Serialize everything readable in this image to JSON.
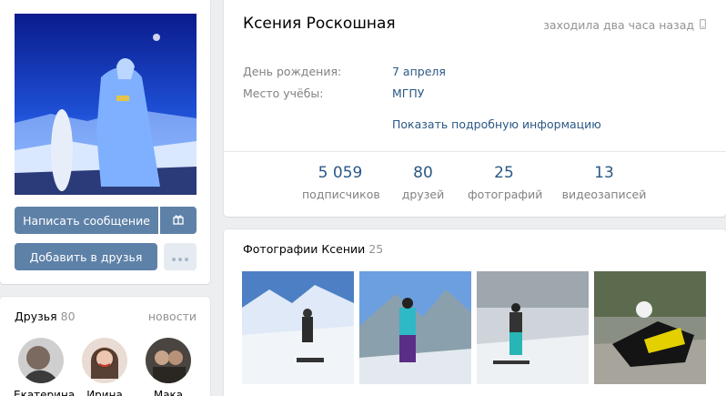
{
  "profile": {
    "name": "Ксения Роскошная",
    "last_seen": "заходила два часа назад",
    "info": [
      {
        "label": "День рождения:",
        "value": "7 апреля"
      },
      {
        "label": "Место учёбы:",
        "value": "МГПУ"
      }
    ],
    "more_info_link": "Показать подробную информацию"
  },
  "actions": {
    "message_label": "Написать сообщение",
    "gift_icon": "gift-icon",
    "add_friend_label": "Добавить в друзья",
    "more_icon": "more-dots-icon"
  },
  "counters": [
    {
      "value": "5 059",
      "label": "подписчиков"
    },
    {
      "value": "80",
      "label": "друзей"
    },
    {
      "value": "25",
      "label": "фотографий"
    },
    {
      "value": "13",
      "label": "видеозаписей"
    }
  ],
  "friends": {
    "title": "Друзья",
    "count": "80",
    "news_link": "новости",
    "items": [
      {
        "name": "Екатерина"
      },
      {
        "name": "Ирина"
      },
      {
        "name": "Мака"
      }
    ]
  },
  "photos": {
    "title": "Фотографии Ксении",
    "count": "25"
  },
  "colors": {
    "accent": "#5e81a8",
    "link": "#2a5885",
    "muted": "#828282",
    "background": "#edeef0"
  }
}
